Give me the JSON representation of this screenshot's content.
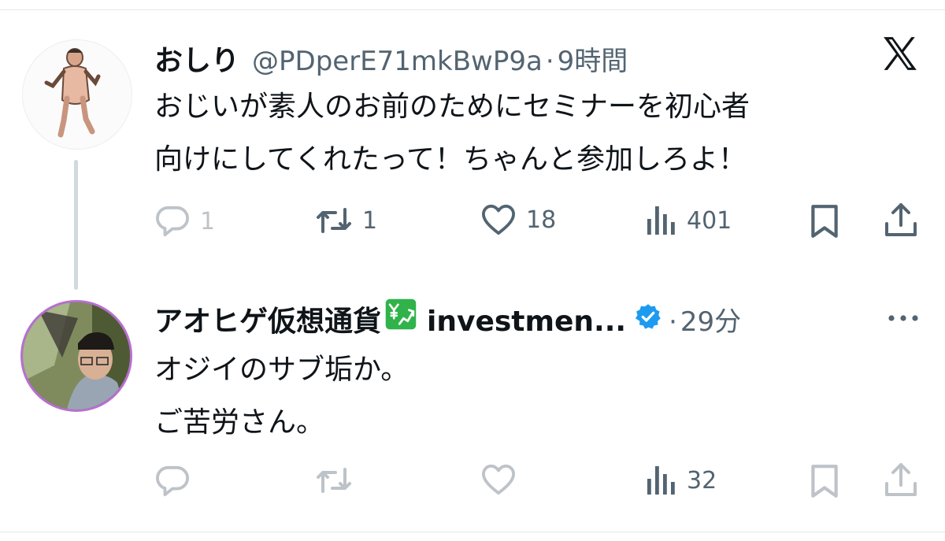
{
  "tweet1": {
    "display_name": "おしり",
    "handle": "@PDperE71mkBwP9a",
    "separator": "·",
    "time": "9時間",
    "text_lines": [
      "おじいが素人のお前のためにセミナーを初心者",
      "向けにしてくれたって！ちゃんと参加しろよ！"
    ],
    "actions": {
      "replies": "1",
      "reposts": "1",
      "likes": "18",
      "views": "401"
    }
  },
  "tweet2": {
    "display_name": "アオヒゲ仮想通貨",
    "handle": "investmen...",
    "separator": "·",
    "time": "29分",
    "text_lines": [
      "オジイのサブ垢か。",
      "ご苦労さん。"
    ],
    "actions": {
      "views": "32"
    }
  },
  "icons": {
    "brand": "x-logo-icon",
    "reply": "reply-icon",
    "repost": "repost-icon",
    "like": "heart-icon",
    "views": "views-icon",
    "bookmark": "bookmark-icon",
    "share": "share-icon",
    "more": "more-icon",
    "verified": "verified-badge-icon",
    "chart_emoji": "yen-chart-icon"
  },
  "colors": {
    "text": "#0f1419",
    "secondary": "#536471",
    "verified": "#1d9bf0",
    "thread_line": "#cfd9de",
    "avatar_ring": "#b76fd1"
  }
}
